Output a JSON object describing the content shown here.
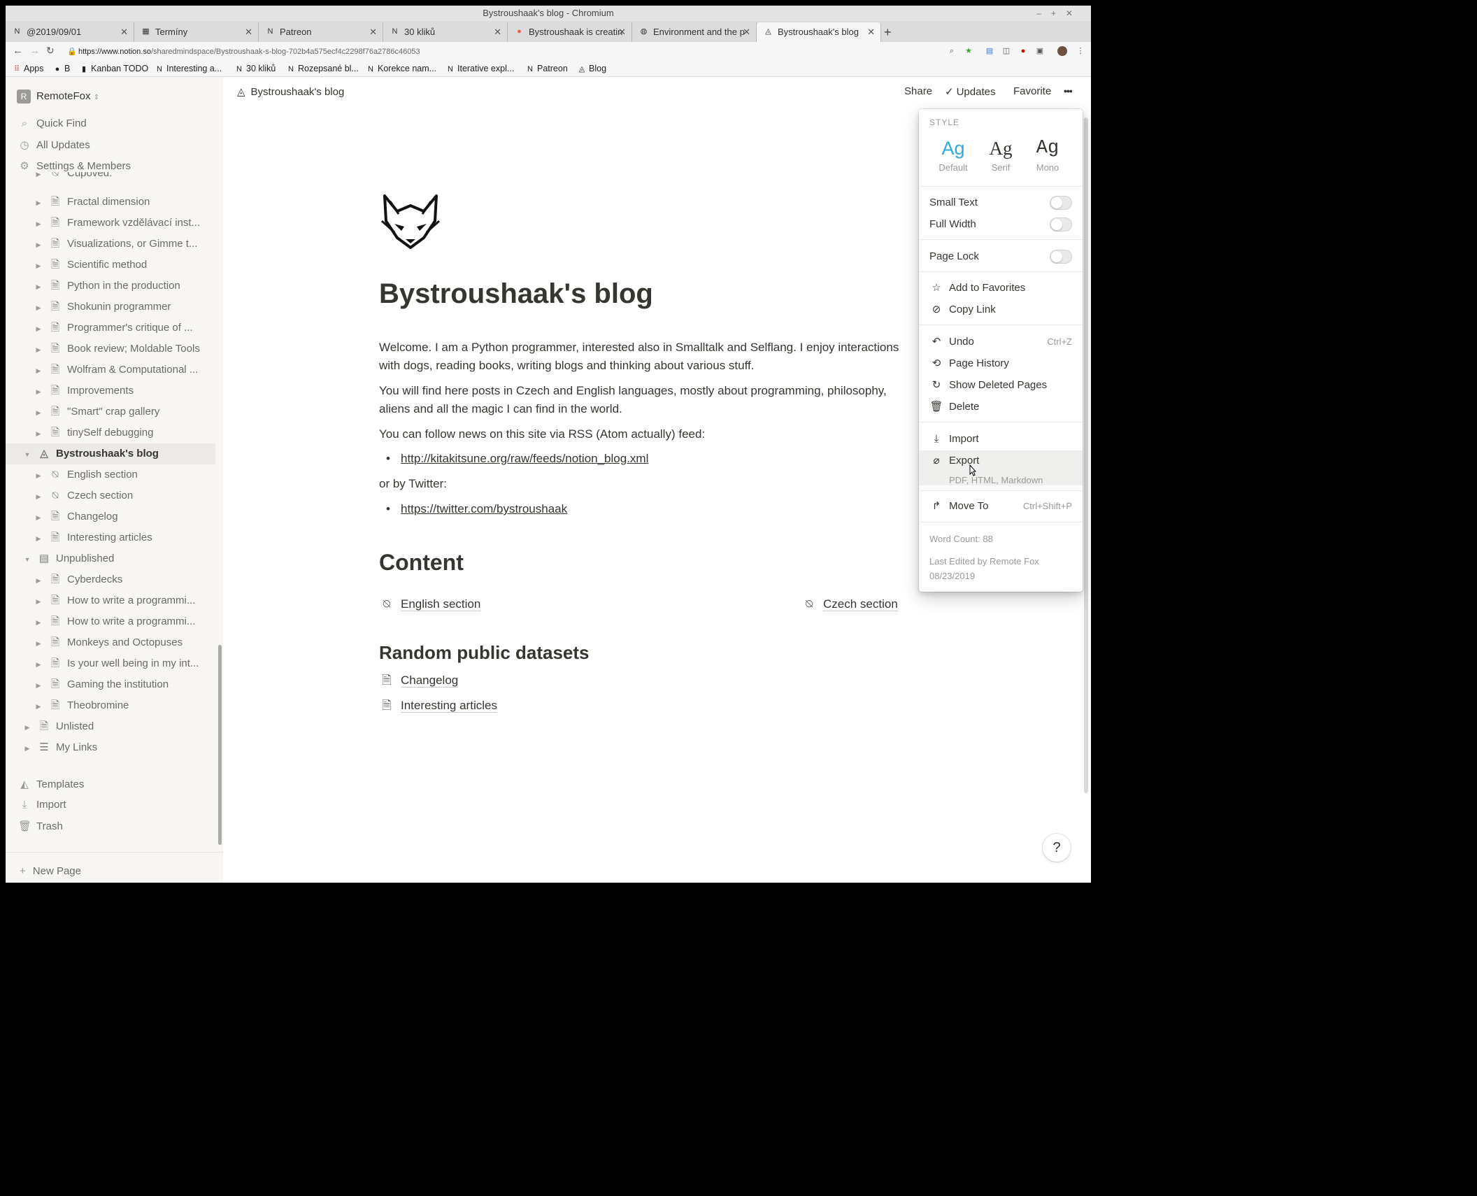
{
  "window": {
    "title": "Bystroushaak's blog - Chromium"
  },
  "tabs": [
    {
      "label": "@2019/09/01",
      "icon": "notion-icon"
    },
    {
      "label": "Termíny",
      "icon": "calendar-icon"
    },
    {
      "label": "Patreon",
      "icon": "notion-icon"
    },
    {
      "label": "30 kliků",
      "icon": "notion-icon"
    },
    {
      "label": "Bystroushaak is creatin",
      "icon": "patreon-icon"
    },
    {
      "label": "Environment and the p",
      "icon": "globe-icon"
    },
    {
      "label": "Bystroushaak's blog",
      "icon": "fox-icon"
    }
  ],
  "address": {
    "url_prefix": "https://www.notion.so",
    "url_rest": "/sharedmindspace/Bystroushaak-s-blog-702b4a575ecf4c2298f76a2786c46053"
  },
  "bookmarks": [
    {
      "label": "Apps"
    },
    {
      "label": "B"
    },
    {
      "label": "Kanban TODO"
    },
    {
      "label": "Interesting a..."
    },
    {
      "label": "30 kliků"
    },
    {
      "label": "Rozepsané bl..."
    },
    {
      "label": "Korekce nam..."
    },
    {
      "label": "Iterative expl..."
    },
    {
      "label": "Patreon"
    },
    {
      "label": "Blog"
    }
  ],
  "sidebar": {
    "workspace": "RemoteFox",
    "workspace_initial": "R",
    "nav": [
      {
        "label": "Quick Find",
        "icon": "search-icon"
      },
      {
        "label": "All Updates",
        "icon": "clock-icon"
      },
      {
        "label": "Settings & Members",
        "icon": "gear-icon"
      }
    ],
    "tree": [
      {
        "label": "Cupoved.",
        "depth": 1
      },
      {
        "label": "Fractal dimension",
        "depth": 1
      },
      {
        "label": "Framework vzdělávací inst...",
        "depth": 1
      },
      {
        "label": "Visualizations, or Gimme t...",
        "depth": 1
      },
      {
        "label": "Scientific method",
        "depth": 1
      },
      {
        "label": "Python in the production",
        "depth": 1
      },
      {
        "label": "Shokunin programmer",
        "depth": 1
      },
      {
        "label": "Programmer's critique of ...",
        "depth": 1
      },
      {
        "label": "Book review; Moldable Tools",
        "depth": 1
      },
      {
        "label": "Wolfram & Computational ...",
        "depth": 1
      },
      {
        "label": "Improvements",
        "depth": 1
      },
      {
        "label": "\"Smart\" crap gallery",
        "depth": 1
      },
      {
        "label": "tinySelf debugging",
        "depth": 1
      },
      {
        "label": "Bystroushaak's blog",
        "depth": 0
      },
      {
        "label": "English section",
        "depth": 1
      },
      {
        "label": "Czech section",
        "depth": 1
      },
      {
        "label": "Changelog",
        "depth": 1
      },
      {
        "label": "Interesting articles",
        "depth": 1
      },
      {
        "label": "Unpublished",
        "depth": 0
      },
      {
        "label": "Cyberdecks",
        "depth": 1
      },
      {
        "label": "How to write a programmi...",
        "depth": 1
      },
      {
        "label": "How to write a programmi...",
        "depth": 1
      },
      {
        "label": "Monkeys and Octopuses",
        "depth": 1
      },
      {
        "label": "Is your well being in my int...",
        "depth": 1
      },
      {
        "label": "Gaming the institution",
        "depth": 1
      },
      {
        "label": "Theobromine",
        "depth": 1
      },
      {
        "label": "Unlisted",
        "depth": 0
      },
      {
        "label": "My Links",
        "depth": 0
      }
    ],
    "bottom": [
      {
        "label": "Templates",
        "icon": "shapes-icon"
      },
      {
        "label": "Import",
        "icon": "download-icon"
      },
      {
        "label": "Trash",
        "icon": "trash-icon"
      }
    ],
    "new_page": "New Page"
  },
  "topbar": {
    "breadcrumb": "Bystroushaak's blog",
    "share": "Share",
    "updates": "Updates",
    "favorite": "Favorite",
    "more": "•••"
  },
  "page": {
    "title": "Bystroushaak's blog",
    "p1": "Welcome. I am a Python programmer, interested also in Smalltalk and Selflang. I enjoy interactions with dogs, reading books, writing blogs and thinking about various stuff.",
    "p2": "You will find here posts in Czech and English languages, mostly about programming, philosophy, aliens and all the magic I can find in the world.",
    "p3": "You can follow news on this site via RSS (Atom actually) feed:",
    "rss": "http://kitakitsune.org/raw/feeds/notion_blog.xml",
    "p4": "or by Twitter:",
    "twitter": "https://twitter.com/bystroushaak",
    "h_content": "Content",
    "english": "English section",
    "czech": "Czech section",
    "h_datasets": "Random public datasets",
    "changelog": "Changelog",
    "articles": "Interesting articles"
  },
  "menu": {
    "style_label": "STYLE",
    "styles": [
      {
        "glyph": "Ag",
        "name": "Default",
        "selected": true
      },
      {
        "glyph": "Ag",
        "name": "Serif",
        "selected": false
      },
      {
        "glyph": "Ag",
        "name": "Mono",
        "selected": false
      }
    ],
    "small_text": "Small Text",
    "full_width": "Full Width",
    "page_lock": "Page Lock",
    "add_favorites": "Add to Favorites",
    "copy_link": "Copy Link",
    "undo": "Undo",
    "undo_shortcut": "Ctrl+Z",
    "page_history": "Page History",
    "show_deleted": "Show Deleted Pages",
    "delete": "Delete",
    "import": "Import",
    "export": "Export",
    "export_sub": "PDF, HTML, Markdown",
    "move_to": "Move To",
    "move_shortcut": "Ctrl+Shift+P",
    "word_count": "Word Count: 88",
    "last_edited": "Last Edited by Remote Fox",
    "last_date": "08/23/2019"
  },
  "colors": {
    "accent": "#2eaadc",
    "text": "#37352f",
    "muted": "#9b9a97",
    "sidebar_bg": "#f7f6f3"
  }
}
